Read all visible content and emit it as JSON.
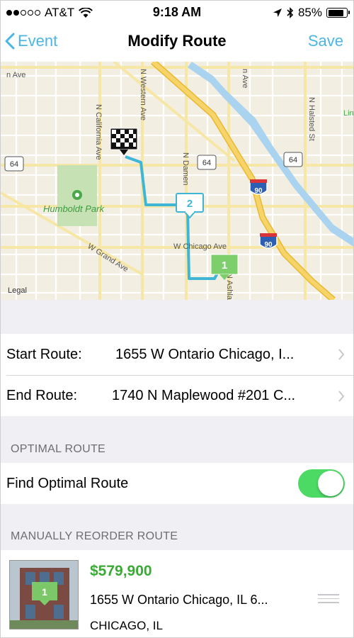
{
  "status_bar": {
    "carrier": "AT&T",
    "time": "9:18 AM",
    "battery": "85%",
    "battery_level": 0.85,
    "signal_bars": 2
  },
  "nav": {
    "back_label": "Event",
    "title": "Modify Route",
    "save_label": "Save"
  },
  "map": {
    "labels": {
      "street_ave_top_left": "n Ave",
      "street_western": "N Western Ave",
      "street_california": "N California Ave",
      "street_damen": "N Damen",
      "street_halsted": "N Halsted St",
      "street_ave_top_right": "n Ave",
      "park": "Humboldt Park",
      "chicago_ave": "W Chicago Ave",
      "grand_ave": "W Grand Ave",
      "ashland": "N Ashla",
      "legal": "Legal",
      "edge_label": "Lin"
    },
    "shields": [
      "64",
      "64",
      "64",
      "90",
      "90"
    ],
    "waypoints": [
      "2",
      "1"
    ]
  },
  "route": {
    "start_label": "Start Route:",
    "start_value": "1655 W Ontario Chicago, I...",
    "end_label": "End Route:",
    "end_value": "1740 N Maplewood #201 C..."
  },
  "optimal": {
    "header": "OPTIMAL ROUTE",
    "find_label": "Find Optimal Route",
    "enabled": true
  },
  "reorder": {
    "header": "MANUALLY REORDER ROUTE",
    "items": [
      {
        "marker": "1",
        "price": "$579,900",
        "address": "1655 W Ontario Chicago, IL 6...",
        "city": "CHICAGO, IL"
      }
    ]
  },
  "colors": {
    "accent": "#4bb6e4",
    "price": "#3ba935",
    "toggle_on": "#4cd964",
    "route_line": "#3fb6d6",
    "highway": "#f2c94c",
    "marker_green": "#7ccf6a"
  }
}
